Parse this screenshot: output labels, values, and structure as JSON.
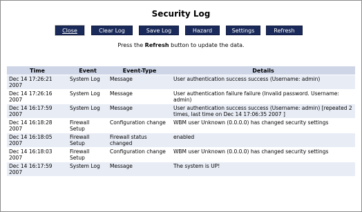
{
  "title": "Security Log",
  "toolbar": {
    "close_label": "Close",
    "clear_label": "Clear Log",
    "save_label": "Save Log",
    "hazard_label": "Hazard",
    "settings_label": "Settings",
    "refresh_label": "Refresh"
  },
  "hint": {
    "prefix": "Press the ",
    "bold": "Refresh",
    "suffix": " button to update the data."
  },
  "table": {
    "headers": [
      "Time",
      "Event",
      "Event-Type",
      "Details"
    ],
    "rows": [
      {
        "time": "Dec 14 17:26:21 2007",
        "event": "System Log",
        "type": "Message",
        "details": "User authentication success success (Username: admin)"
      },
      {
        "time": "Dec 14 17:26:16 2007",
        "event": "System Log",
        "type": "Message",
        "details": "User authentication failure failure (Invalid password. Username: admin)"
      },
      {
        "time": "Dec 14 16:17:59 2007",
        "event": "System Log",
        "type": "Message",
        "details": "User authentication success success (Username: admin) [repeated 2 times, last time on Dec 14 17:06:35 2007 ]"
      },
      {
        "time": "Dec 14 16:18:28 2007",
        "event": "Firewall Setup",
        "type": "Configuration change",
        "details": "WBM user Unknown (0.0.0.0) has changed security settings"
      },
      {
        "time": "Dec 14 16:18:05 2007",
        "event": "Firewall Setup",
        "type": "Firewall status changed",
        "details": "enabled"
      },
      {
        "time": "Dec 14 16:18:03 2007",
        "event": "Firewall Setup",
        "type": "Configuration change",
        "details": "WBM user Unknown (0.0.0.0) has changed security settings"
      },
      {
        "time": "Dec 14 16:17:59 2007",
        "event": "System Log",
        "type": "Message",
        "details": "The system is UP!"
      }
    ]
  }
}
